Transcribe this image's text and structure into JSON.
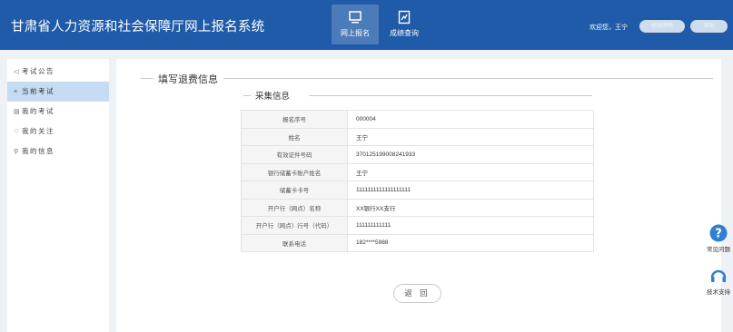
{
  "header": {
    "app_title": "甘肃省人力资源和社会保障厅网上报名系统",
    "nav": [
      {
        "label": "网上报名",
        "icon": "monitor-icon",
        "active": true
      },
      {
        "label": "成绩查询",
        "icon": "chart-icon",
        "active": false
      }
    ],
    "welcome": "欢迎您，王宁",
    "buttons": [
      "修改密码",
      "退出"
    ]
  },
  "sidebar": {
    "items": [
      {
        "label": "考试公告",
        "icon": "megaphone-icon",
        "glyph": "◁",
        "active": false
      },
      {
        "label": "当前考试",
        "icon": "list-icon",
        "glyph": "≡",
        "active": true
      },
      {
        "label": "我的考试",
        "icon": "document-icon",
        "glyph": "▤",
        "active": false
      },
      {
        "label": "我的关注",
        "icon": "heart-icon",
        "glyph": "♡",
        "active": false
      },
      {
        "label": "我的信息",
        "icon": "user-icon",
        "glyph": "⚲",
        "active": false
      }
    ]
  },
  "main": {
    "section_title": "填写退费信息",
    "sub_title": "采集信息",
    "fields": [
      {
        "label": "报名序号",
        "value": "000004"
      },
      {
        "label": "姓名",
        "value": "王宁"
      },
      {
        "label": "有效证件号码",
        "value": "370125199008241933"
      },
      {
        "label": "银行储蓄卡账户姓名",
        "value": "王宁"
      },
      {
        "label": "储蓄卡卡号",
        "value": "1111111111111111111"
      },
      {
        "label": "开户行（网点）名称",
        "value": "XX银行XX支行"
      },
      {
        "label": "开户行（网点）行号（代码）",
        "value": "111111111111"
      },
      {
        "label": "联系电话",
        "value": "182****5988"
      }
    ],
    "back_label": "返 回"
  },
  "float": {
    "faq_label": "常见问题",
    "faq_icon": "question-icon",
    "support_label": "技术支持",
    "support_icon": "headset-icon"
  },
  "colors": {
    "header_bg": "#1f5ba8",
    "sidebar_active": "#c5dcf3",
    "float_icon": "#2f7fd2"
  }
}
